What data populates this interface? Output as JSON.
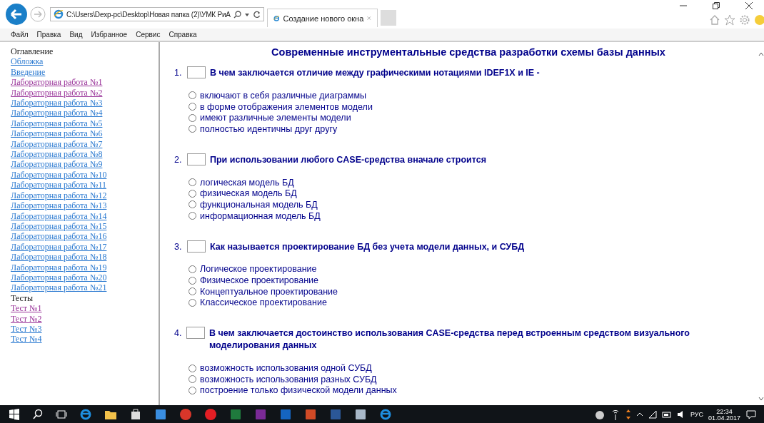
{
  "browser": {
    "address": "C:\\Users\\Dexp-pc\\Desktop\\Новая папка (2)\\УМК РиА",
    "tabs": [
      {
        "label": "Создание нового окна",
        "selected": true
      }
    ]
  },
  "menu": [
    "Файл",
    "Правка",
    "Вид",
    "Избранное",
    "Сервис",
    "Справка"
  ],
  "sidebar": {
    "items": [
      {
        "kind": "heading",
        "label": "Оглавление"
      },
      {
        "kind": "link",
        "label": "Обложка",
        "visited": false
      },
      {
        "kind": "link",
        "label": "Введение",
        "visited": false
      },
      {
        "kind": "link",
        "label": "Лабораторная работа №1",
        "visited": true
      },
      {
        "kind": "link",
        "label": "Лабораторная работа №2",
        "visited": true
      },
      {
        "kind": "link",
        "label": "Лабораторная работа №3",
        "visited": false
      },
      {
        "kind": "link",
        "label": "Лабораторная работа №4",
        "visited": false
      },
      {
        "kind": "link",
        "label": "Лабораторная работа №5",
        "visited": false
      },
      {
        "kind": "link",
        "label": "Лабораторная работа №6",
        "visited": false
      },
      {
        "kind": "link",
        "label": "Лабораторная работа №7",
        "visited": false
      },
      {
        "kind": "link",
        "label": "Лабораторная работа №8",
        "visited": false
      },
      {
        "kind": "link",
        "label": "Лабораторная работа №9",
        "visited": false
      },
      {
        "kind": "link",
        "label": "Лабораторная работа №10",
        "visited": false
      },
      {
        "kind": "link",
        "label": "Лабораторная работа №11",
        "visited": false
      },
      {
        "kind": "link",
        "label": "Лабораторная работа №12",
        "visited": false
      },
      {
        "kind": "link",
        "label": "Лабораторная работа №13",
        "visited": false
      },
      {
        "kind": "link",
        "label": "Лабораторная работа №14",
        "visited": false
      },
      {
        "kind": "link",
        "label": "Лабораторная работа №15",
        "visited": false
      },
      {
        "kind": "link",
        "label": "Лабораторная работа №16",
        "visited": false
      },
      {
        "kind": "link",
        "label": "Лабораторная работа №17",
        "visited": false
      },
      {
        "kind": "link",
        "label": "Лабораторная работа №18",
        "visited": false
      },
      {
        "kind": "link",
        "label": "Лабораторная работа №19",
        "visited": false
      },
      {
        "kind": "link",
        "label": "Лабораторная работа №20",
        "visited": false
      },
      {
        "kind": "link",
        "label": "Лабораторная работа №21",
        "visited": false
      },
      {
        "kind": "heading",
        "label": "Тесты"
      },
      {
        "kind": "link",
        "label": "Тест №1",
        "visited": true
      },
      {
        "kind": "link",
        "label": "Тест №2",
        "visited": true
      },
      {
        "kind": "link",
        "label": "Тест №3",
        "visited": false
      },
      {
        "kind": "link",
        "label": "Тест №4",
        "visited": false
      }
    ]
  },
  "quiz": {
    "title": "Современные инструментальные средства разработки схемы базы данных",
    "questions": [
      {
        "number": "1.",
        "text": "В чем заключается отличие между графическими нотациями IDEF1X и IE -",
        "options": [
          {
            "label": "включают в себя различные диаграммы",
            "selected": false
          },
          {
            "label": "в форме отображения элементов модели",
            "selected": false
          },
          {
            "label": "имеют различные элементы модели",
            "selected": false
          },
          {
            "label": "полностью идентичны друг другу",
            "selected": false
          }
        ]
      },
      {
        "number": "2.",
        "text": "При использовании любого CASE-средства вначале строится",
        "options": [
          {
            "label": "логическая модель БД",
            "selected": false
          },
          {
            "label": "физическая модель БД",
            "selected": false
          },
          {
            "label": "функциональная модель БД",
            "selected": false
          },
          {
            "label": "информационная модель БД",
            "selected": false
          }
        ]
      },
      {
        "number": "3.",
        "text": "Как называется проектирование БД без учета модели данных, и СУБД",
        "options": [
          {
            "label": "Логическое проектирование",
            "selected": false
          },
          {
            "label": "Физическое проектирование",
            "selected": false
          },
          {
            "label": "Концептуальное проектирование",
            "selected": false
          },
          {
            "label": "Классическое проектирование",
            "selected": false
          }
        ]
      },
      {
        "number": "4.",
        "text": "В чем заключается достоинство использования CASE-средства перед встроенным средством визуального моделирования данных",
        "options": [
          {
            "label": "возможность использования одной СУБД",
            "selected": false
          },
          {
            "label": "возможность использования разных СУБД",
            "selected": false
          },
          {
            "label": "построение только физической модели данных",
            "selected": false
          }
        ]
      }
    ]
  },
  "taskbar": {
    "language": "РУС",
    "time": "22:34",
    "date": "01.04.2017"
  }
}
